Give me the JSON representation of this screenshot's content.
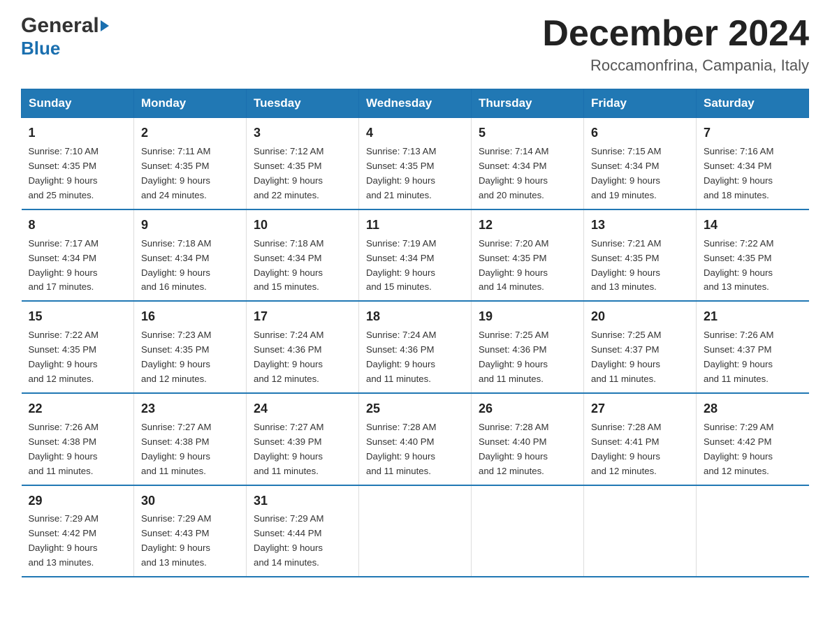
{
  "header": {
    "logo": {
      "general": "General",
      "blue": "Blue",
      "aria": "GeneralBlue logo"
    },
    "title": "December 2024",
    "location": "Roccamonfrina, Campania, Italy"
  },
  "calendar": {
    "days_of_week": [
      "Sunday",
      "Monday",
      "Tuesday",
      "Wednesday",
      "Thursday",
      "Friday",
      "Saturday"
    ],
    "weeks": [
      [
        {
          "day": "1",
          "sunrise": "7:10 AM",
          "sunset": "4:35 PM",
          "daylight": "9 hours and 25 minutes."
        },
        {
          "day": "2",
          "sunrise": "7:11 AM",
          "sunset": "4:35 PM",
          "daylight": "9 hours and 24 minutes."
        },
        {
          "day": "3",
          "sunrise": "7:12 AM",
          "sunset": "4:35 PM",
          "daylight": "9 hours and 22 minutes."
        },
        {
          "day": "4",
          "sunrise": "7:13 AM",
          "sunset": "4:35 PM",
          "daylight": "9 hours and 21 minutes."
        },
        {
          "day": "5",
          "sunrise": "7:14 AM",
          "sunset": "4:34 PM",
          "daylight": "9 hours and 20 minutes."
        },
        {
          "day": "6",
          "sunrise": "7:15 AM",
          "sunset": "4:34 PM",
          "daylight": "9 hours and 19 minutes."
        },
        {
          "day": "7",
          "sunrise": "7:16 AM",
          "sunset": "4:34 PM",
          "daylight": "9 hours and 18 minutes."
        }
      ],
      [
        {
          "day": "8",
          "sunrise": "7:17 AM",
          "sunset": "4:34 PM",
          "daylight": "9 hours and 17 minutes."
        },
        {
          "day": "9",
          "sunrise": "7:18 AM",
          "sunset": "4:34 PM",
          "daylight": "9 hours and 16 minutes."
        },
        {
          "day": "10",
          "sunrise": "7:18 AM",
          "sunset": "4:34 PM",
          "daylight": "9 hours and 15 minutes."
        },
        {
          "day": "11",
          "sunrise": "7:19 AM",
          "sunset": "4:34 PM",
          "daylight": "9 hours and 15 minutes."
        },
        {
          "day": "12",
          "sunrise": "7:20 AM",
          "sunset": "4:35 PM",
          "daylight": "9 hours and 14 minutes."
        },
        {
          "day": "13",
          "sunrise": "7:21 AM",
          "sunset": "4:35 PM",
          "daylight": "9 hours and 13 minutes."
        },
        {
          "day": "14",
          "sunrise": "7:22 AM",
          "sunset": "4:35 PM",
          "daylight": "9 hours and 13 minutes."
        }
      ],
      [
        {
          "day": "15",
          "sunrise": "7:22 AM",
          "sunset": "4:35 PM",
          "daylight": "9 hours and 12 minutes."
        },
        {
          "day": "16",
          "sunrise": "7:23 AM",
          "sunset": "4:35 PM",
          "daylight": "9 hours and 12 minutes."
        },
        {
          "day": "17",
          "sunrise": "7:24 AM",
          "sunset": "4:36 PM",
          "daylight": "9 hours and 12 minutes."
        },
        {
          "day": "18",
          "sunrise": "7:24 AM",
          "sunset": "4:36 PM",
          "daylight": "9 hours and 11 minutes."
        },
        {
          "day": "19",
          "sunrise": "7:25 AM",
          "sunset": "4:36 PM",
          "daylight": "9 hours and 11 minutes."
        },
        {
          "day": "20",
          "sunrise": "7:25 AM",
          "sunset": "4:37 PM",
          "daylight": "9 hours and 11 minutes."
        },
        {
          "day": "21",
          "sunrise": "7:26 AM",
          "sunset": "4:37 PM",
          "daylight": "9 hours and 11 minutes."
        }
      ],
      [
        {
          "day": "22",
          "sunrise": "7:26 AM",
          "sunset": "4:38 PM",
          "daylight": "9 hours and 11 minutes."
        },
        {
          "day": "23",
          "sunrise": "7:27 AM",
          "sunset": "4:38 PM",
          "daylight": "9 hours and 11 minutes."
        },
        {
          "day": "24",
          "sunrise": "7:27 AM",
          "sunset": "4:39 PM",
          "daylight": "9 hours and 11 minutes."
        },
        {
          "day": "25",
          "sunrise": "7:28 AM",
          "sunset": "4:40 PM",
          "daylight": "9 hours and 11 minutes."
        },
        {
          "day": "26",
          "sunrise": "7:28 AM",
          "sunset": "4:40 PM",
          "daylight": "9 hours and 12 minutes."
        },
        {
          "day": "27",
          "sunrise": "7:28 AM",
          "sunset": "4:41 PM",
          "daylight": "9 hours and 12 minutes."
        },
        {
          "day": "28",
          "sunrise": "7:29 AM",
          "sunset": "4:42 PM",
          "daylight": "9 hours and 12 minutes."
        }
      ],
      [
        {
          "day": "29",
          "sunrise": "7:29 AM",
          "sunset": "4:42 PM",
          "daylight": "9 hours and 13 minutes."
        },
        {
          "day": "30",
          "sunrise": "7:29 AM",
          "sunset": "4:43 PM",
          "daylight": "9 hours and 13 minutes."
        },
        {
          "day": "31",
          "sunrise": "7:29 AM",
          "sunset": "4:44 PM",
          "daylight": "9 hours and 14 minutes."
        },
        null,
        null,
        null,
        null
      ]
    ],
    "labels": {
      "sunrise": "Sunrise:",
      "sunset": "Sunset:",
      "daylight": "Daylight:"
    }
  },
  "colors": {
    "header_bg": "#2178b4",
    "header_text": "#ffffff",
    "border": "#2178b4",
    "text_primary": "#222222",
    "text_secondary": "#555555"
  }
}
